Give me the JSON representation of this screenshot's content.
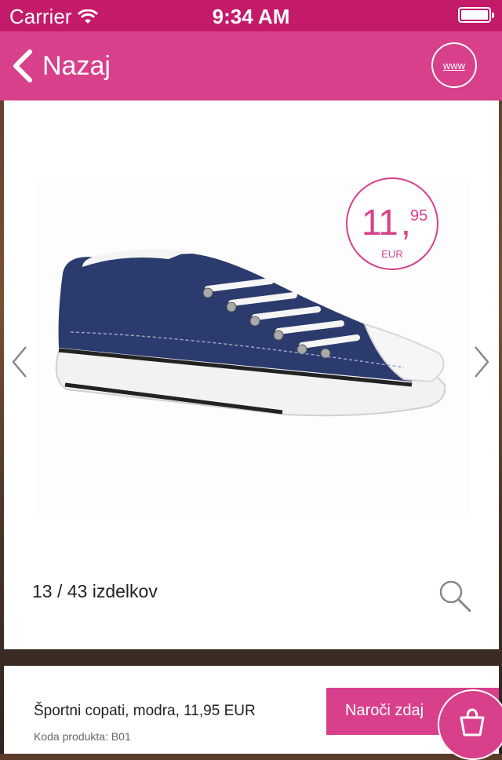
{
  "status_bar": {
    "carrier": "Carrier",
    "time": "9:34 AM"
  },
  "nav": {
    "back_label": "Nazaj",
    "www_label": "www"
  },
  "product": {
    "price_whole": "11",
    "price_comma": ",",
    "price_cents": "95",
    "currency": "EUR",
    "counter": "13 / 43 izdelkov",
    "name_line": "Športni copati, modra, 11,95 EUR",
    "code_line": "Koda produkta: B01"
  },
  "actions": {
    "order_label": "Naroči zdaj"
  },
  "colors": {
    "brand": "#d8408c",
    "status_bar": "#c41a6a",
    "shoe_canvas": "#2c3b6e"
  },
  "icons": [
    "wifi-icon",
    "battery-icon",
    "chevron-left-icon",
    "globe-www-icon",
    "chevron-right-icon",
    "magnifier-icon",
    "shopping-bag-icon"
  ]
}
